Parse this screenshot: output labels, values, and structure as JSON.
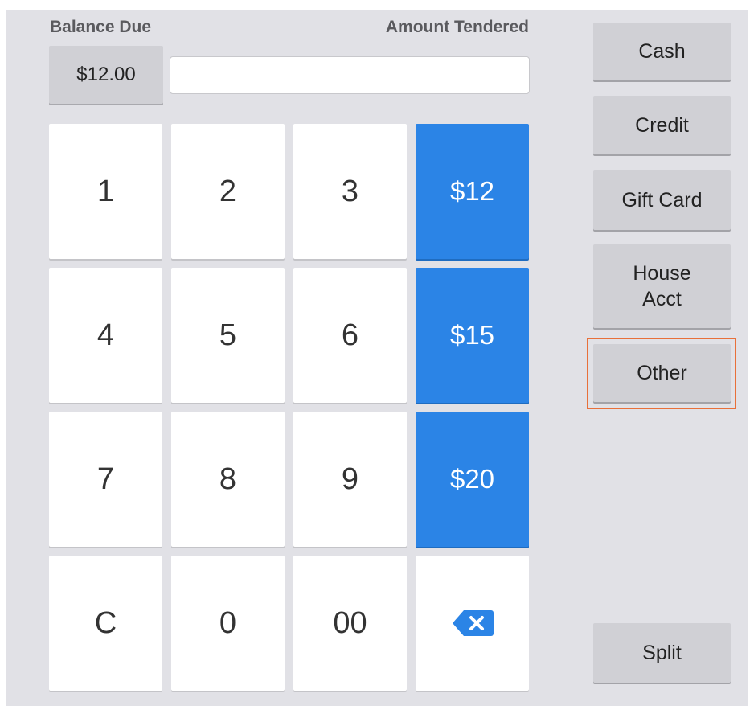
{
  "header": {
    "balance_label": "Balance Due",
    "tendered_label": "Amount Tendered"
  },
  "balance": {
    "value": "$12.00"
  },
  "tendered_input": {
    "value": "",
    "placeholder": ""
  },
  "keypad": {
    "k1": "1",
    "k2": "2",
    "k3": "3",
    "k4": "4",
    "k5": "5",
    "k6": "6",
    "k7": "7",
    "k8": "8",
    "k9": "9",
    "kc": "C",
    "k0": "0",
    "k00": "00",
    "backspace_icon": "backspace-icon"
  },
  "quick_amounts": {
    "q12": "$12",
    "q15": "$15",
    "q20": "$20"
  },
  "payment_methods": {
    "cash": "Cash",
    "credit": "Credit",
    "gift_card": "Gift Card",
    "house_acct": "House\nAcct",
    "other": "Other",
    "split": "Split"
  },
  "colors": {
    "panel_bg": "#e1e1e6",
    "quick_amount_blue": "#2b84e6",
    "highlight_orange": "#e8703a"
  }
}
